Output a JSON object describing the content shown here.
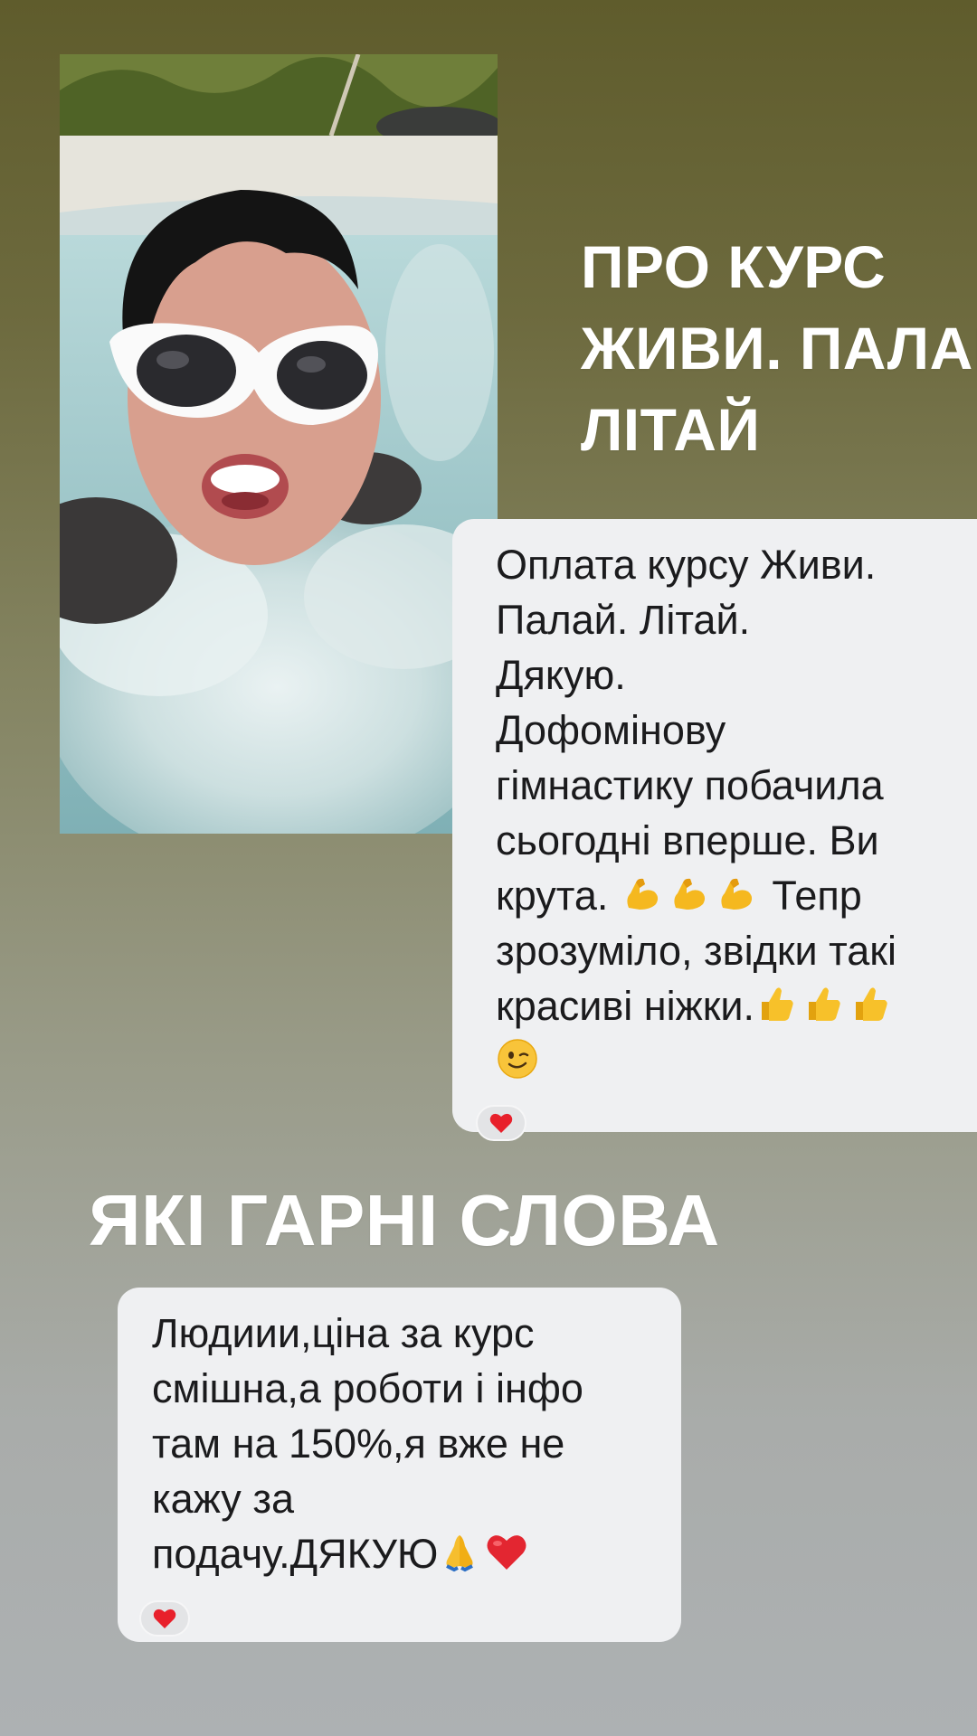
{
  "headline_top": {
    "line1": "ПРО КУРС",
    "line2": "ЖИВИ. ПАЛАЙ.",
    "line3": "ЛІТАЙ"
  },
  "headline_bottom": "ЯКІ ГАРНІ СЛОВА",
  "message_1": {
    "line1": "Оплата курсу Живи.",
    "line2": "Палай. Літай.",
    "line3": "Дякую.",
    "line4": "Дофомінову",
    "line5": "гімнастику побачила",
    "line6": "сьогодні вперше. Ви",
    "line7a": "крута.",
    "line7b": "Тепр",
    "line8": "зрозуміло, звідки такі",
    "line9": "красиві ніжки.",
    "emojis": [
      "flexed-biceps-icon",
      "thumbs-up-icon",
      "winking-face-icon"
    ],
    "reaction": "red-heart"
  },
  "message_2": {
    "line1": "Людиии,ціна за курс",
    "line2": "смішна,а роботи і інфо",
    "line3": "там на 150%,я вже не",
    "line4": "кажу за",
    "line5": "подачу.ДЯКУЮ",
    "emojis": [
      "folded-hands-icon",
      "red-heart-icon"
    ],
    "reaction": "red-heart"
  },
  "colors": {
    "background_top": "#5f5c2c",
    "background_bottom": "#adb1b3",
    "bubble": "#eff0f2",
    "text": "#1b1b1d",
    "heart": "#e8202b"
  }
}
